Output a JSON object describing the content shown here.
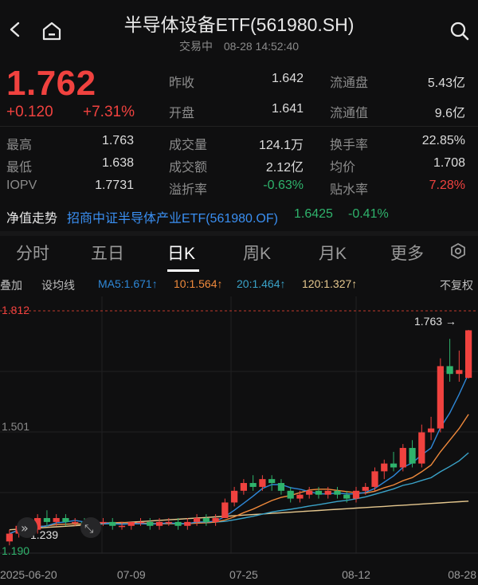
{
  "header": {
    "title": "半导体设备ETF(561980.SH)",
    "status": "交易中",
    "datetime": "08-28 14:52:40"
  },
  "quote": {
    "price": "1.762",
    "change": "+0.120",
    "change_pct": "+7.31%"
  },
  "stats": [
    {
      "label": "昨收",
      "value": "1.642",
      "tone": "normal",
      "col": 1,
      "row": 0
    },
    {
      "label": "流通盘",
      "value": "5.43亿",
      "tone": "normal",
      "col": 2,
      "row": 0
    },
    {
      "label": "开盘",
      "value": "1.641",
      "tone": "normal",
      "col": 1,
      "row": 1
    },
    {
      "label": "流通值",
      "value": "9.6亿",
      "tone": "normal",
      "col": 2,
      "row": 1
    },
    {
      "label": "最高",
      "value": "1.763",
      "tone": "normal",
      "col": 0,
      "row": 2
    },
    {
      "label": "成交量",
      "value": "124.1万",
      "tone": "normal",
      "col": 1,
      "row": 2
    },
    {
      "label": "换手率",
      "value": "22.85%",
      "tone": "normal",
      "col": 2,
      "row": 2
    },
    {
      "label": "最低",
      "value": "1.638",
      "tone": "normal",
      "col": 0,
      "row": 3
    },
    {
      "label": "成交额",
      "value": "2.12亿",
      "tone": "normal",
      "col": 1,
      "row": 3
    },
    {
      "label": "均价",
      "value": "1.708",
      "tone": "normal",
      "col": 2,
      "row": 3
    },
    {
      "label": "IOPV",
      "value": "1.7731",
      "tone": "normal",
      "col": 0,
      "row": 4
    },
    {
      "label": "溢折率",
      "value": "-0.63%",
      "tone": "green",
      "col": 1,
      "row": 4
    },
    {
      "label": "贴水率",
      "value": "7.28%",
      "tone": "red",
      "col": 2,
      "row": 4
    }
  ],
  "nav": {
    "label": "净值走势",
    "fund": "招商中证半导体产业ETF(561980.OF)",
    "value": "1.6425",
    "pct": "-0.41%"
  },
  "tabs": [
    "分时",
    "五日",
    "日K",
    "周K",
    "月K",
    "更多"
  ],
  "active_tab": 2,
  "toolbar": {
    "overlay": "叠加",
    "ma_setting": "设均线",
    "ma5": "MA5:1.671↑",
    "ma10": "10:1.564↑",
    "ma20": "20:1.464↑",
    "ma120": "120:1.327↑",
    "adjust": "不复权"
  },
  "colors": {
    "up": "#f0423f",
    "down": "#2fb36c",
    "ma5": "#2e88d8",
    "ma10": "#f08a3c",
    "ma20": "#3aa3c9",
    "ma120": "#e6c88f",
    "link": "#3a8ff2"
  },
  "chart_data": {
    "type": "candlestick",
    "y_axis_labels": [
      "1.812",
      "1.501",
      "1.190"
    ],
    "ylim": [
      1.19,
      1.812
    ],
    "x_tick_labels": [
      {
        "label": "2025-06-20",
        "index": 0
      },
      {
        "label": "07-09",
        "index": 13
      },
      {
        "label": "07-25",
        "index": 25
      },
      {
        "label": "08-12",
        "index": 37
      },
      {
        "label": "08-28",
        "index": 49
      }
    ],
    "annotations": {
      "high_value": "1.763",
      "low_value": "1.239"
    },
    "candles": [
      [
        1.22,
        1.25,
        1.24,
        1.21
      ],
      [
        1.24,
        1.27,
        1.26,
        1.23
      ],
      [
        1.26,
        1.28,
        1.25,
        1.24
      ],
      [
        1.25,
        1.29,
        1.28,
        1.24
      ],
      [
        1.28,
        1.3,
        1.27,
        1.26
      ],
      [
        1.27,
        1.29,
        1.28,
        1.26
      ],
      [
        1.28,
        1.29,
        1.27,
        1.26
      ],
      [
        1.27,
        1.28,
        1.27,
        1.26
      ],
      [
        1.27,
        1.28,
        1.26,
        1.25
      ],
      [
        1.26,
        1.28,
        1.27,
        1.25
      ],
      [
        1.27,
        1.28,
        1.27,
        1.26
      ],
      [
        1.27,
        1.28,
        1.26,
        1.25
      ],
      [
        1.26,
        1.27,
        1.26,
        1.25
      ],
      [
        1.26,
        1.27,
        1.27,
        1.25
      ],
      [
        1.27,
        1.28,
        1.27,
        1.26
      ],
      [
        1.27,
        1.28,
        1.26,
        1.25
      ],
      [
        1.26,
        1.28,
        1.27,
        1.25
      ],
      [
        1.27,
        1.28,
        1.27,
        1.26
      ],
      [
        1.27,
        1.28,
        1.26,
        1.25
      ],
      [
        1.26,
        1.28,
        1.27,
        1.25
      ],
      [
        1.27,
        1.29,
        1.28,
        1.26
      ],
      [
        1.28,
        1.29,
        1.27,
        1.26
      ],
      [
        1.27,
        1.29,
        1.28,
        1.26
      ],
      [
        1.28,
        1.33,
        1.32,
        1.28
      ],
      [
        1.32,
        1.36,
        1.35,
        1.31
      ],
      [
        1.35,
        1.38,
        1.37,
        1.34
      ],
      [
        1.37,
        1.39,
        1.36,
        1.35
      ],
      [
        1.36,
        1.39,
        1.38,
        1.35
      ],
      [
        1.38,
        1.39,
        1.37,
        1.35
      ],
      [
        1.37,
        1.38,
        1.35,
        1.34
      ],
      [
        1.35,
        1.36,
        1.33,
        1.32
      ],
      [
        1.33,
        1.35,
        1.34,
        1.32
      ],
      [
        1.34,
        1.36,
        1.35,
        1.33
      ],
      [
        1.35,
        1.36,
        1.34,
        1.33
      ],
      [
        1.34,
        1.36,
        1.35,
        1.33
      ],
      [
        1.35,
        1.36,
        1.34,
        1.33
      ],
      [
        1.34,
        1.35,
        1.33,
        1.32
      ],
      [
        1.33,
        1.36,
        1.35,
        1.32
      ],
      [
        1.35,
        1.37,
        1.36,
        1.34
      ],
      [
        1.36,
        1.41,
        1.4,
        1.35
      ],
      [
        1.4,
        1.43,
        1.42,
        1.38
      ],
      [
        1.42,
        1.45,
        1.41,
        1.4
      ],
      [
        1.41,
        1.47,
        1.46,
        1.4
      ],
      [
        1.46,
        1.48,
        1.42,
        1.41
      ],
      [
        1.42,
        1.52,
        1.5,
        1.41
      ],
      [
        1.5,
        1.54,
        1.51,
        1.48
      ],
      [
        1.51,
        1.69,
        1.67,
        1.5
      ],
      [
        1.67,
        1.74,
        1.65,
        1.63
      ],
      [
        1.65,
        1.71,
        1.66,
        1.63
      ],
      [
        1.64,
        1.763,
        1.762,
        1.638
      ]
    ]
  }
}
